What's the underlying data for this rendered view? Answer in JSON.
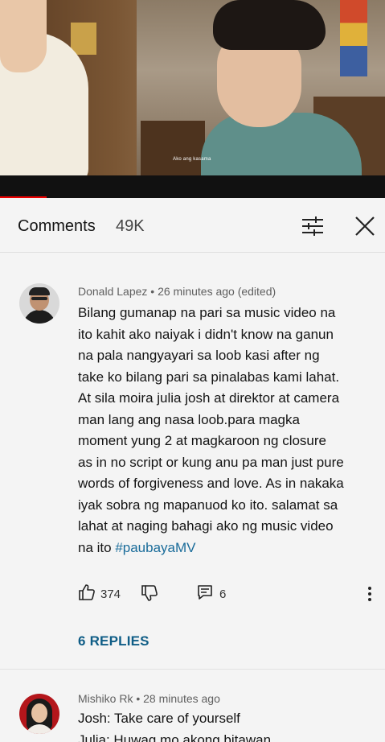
{
  "video": {
    "subtitle": "Ako ang kasama"
  },
  "comments_header": {
    "title": "Comments",
    "count": "49K"
  },
  "comments": [
    {
      "author": "Donald Lapez",
      "meta": "Donald Lapez • 26 minutes ago (edited)",
      "lines": [
        "Bilang gumanap na pari sa music video na",
        "ito kahit ako naiyak i didn't know na ganun",
        "na pala nangyayari sa loob kasi after ng",
        "take ko bilang pari sa pinalabas kami lahat.",
        "At sila moira julia josh at direktor at camera",
        "man lang ang nasa loob.para magka",
        "moment yung 2 at magkaroon ng closure",
        "as in no script or kung anu pa man just pure",
        "words of forgiveness and love. As in nakaka",
        "iyak sobra ng mapanuod ko ito. salamat sa",
        "lahat at naging bahagi ako ng music video"
      ],
      "last_line_text": "na ito ",
      "hashtag": "#paubayaMV",
      "likes": "374",
      "replies_count": "6",
      "replies_link": "6 REPLIES"
    },
    {
      "author": "Mishiko Rk",
      "meta": "Mishiko Rk • 28 minutes ago",
      "line1": "Josh: Take care of yourself",
      "line2": "Julia: Huwag mo akong bitawan"
    }
  ],
  "colors": {
    "background": "#f4f4f4",
    "hashtag": "#1a6c9a",
    "replies_link": "#0f5d86",
    "progress": "#ee0000"
  },
  "icons": [
    "sort-icon",
    "close-icon",
    "thumbs-up-icon",
    "thumbs-down-icon",
    "reply-icon",
    "more-vert-icon"
  ]
}
